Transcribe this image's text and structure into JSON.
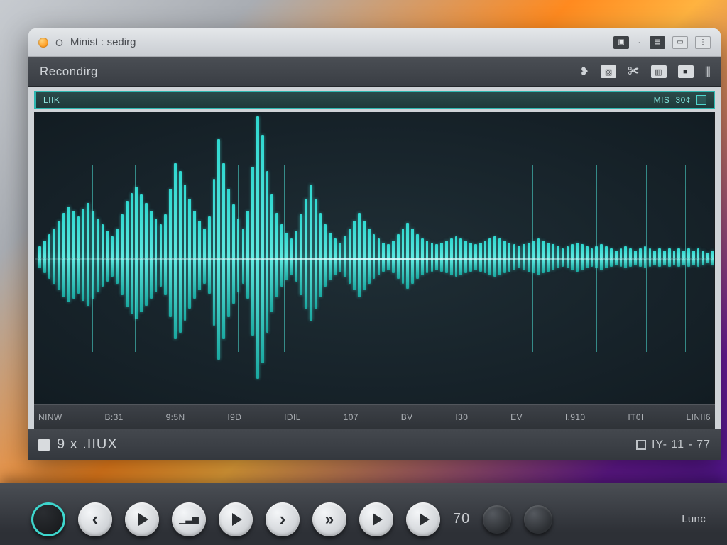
{
  "titlebar": {
    "prefix": "O",
    "title": "Minist : sedirg"
  },
  "secondbar": {
    "label": "Recondirg"
  },
  "trackstrip": {
    "left_label": "LIIK",
    "right_small": "MIS",
    "right_time": "30¢"
  },
  "ruler": {
    "ticks": [
      "NINW",
      "B:31",
      "9:5N",
      "I9D",
      "IDIL",
      "107",
      "BV",
      "I30",
      "EV",
      "I.910",
      "IT0I",
      "LINII6"
    ]
  },
  "statusbar": {
    "left": "9 x  .IIUX",
    "right": "IY- 11 - 77"
  },
  "dock": {
    "number": "70",
    "label": "Lunc"
  },
  "colors": {
    "accent": "#34d6cd",
    "waveform": "#3fe0d6",
    "panel_dark": "#2f3338"
  },
  "waveform": {
    "samples": [
      12,
      18,
      24,
      30,
      38,
      46,
      52,
      48,
      42,
      50,
      56,
      48,
      40,
      34,
      28,
      22,
      30,
      44,
      58,
      66,
      72,
      64,
      56,
      48,
      40,
      34,
      44,
      70,
      96,
      88,
      74,
      60,
      48,
      38,
      30,
      42,
      80,
      120,
      96,
      70,
      54,
      40,
      30,
      48,
      92,
      160,
      124,
      88,
      64,
      46,
      34,
      26,
      20,
      28,
      44,
      60,
      74,
      60,
      46,
      34,
      26,
      20,
      16,
      22,
      30,
      38,
      46,
      38,
      30,
      24,
      20,
      16,
      14,
      18,
      24,
      30,
      36,
      30,
      24,
      20,
      18,
      16,
      14,
      16,
      18,
      20,
      22,
      20,
      18,
      16,
      14,
      16,
      18,
      20,
      22,
      20,
      18,
      16,
      14,
      12,
      14,
      16,
      18,
      20,
      18,
      16,
      14,
      12,
      10,
      12,
      14,
      16,
      14,
      12,
      10,
      12,
      14,
      12,
      10,
      8,
      10,
      12,
      10,
      8,
      10,
      12,
      10,
      8,
      10,
      8,
      10,
      8,
      10,
      8,
      10,
      8,
      10,
      8,
      6,
      8
    ],
    "spikes": [
      80,
      140,
      210,
      285,
      350,
      430,
      520,
      610,
      700,
      790,
      860,
      915
    ]
  }
}
